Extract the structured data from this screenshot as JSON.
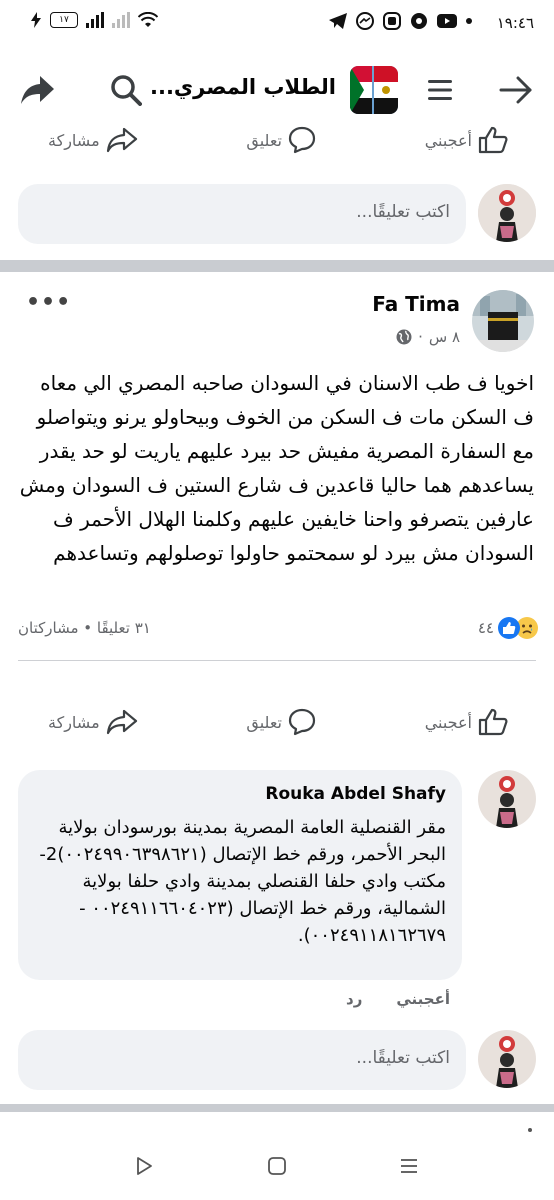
{
  "status_bar": {
    "time": "١٩:٤٦",
    "battery": "١٧"
  },
  "header": {
    "title": "الطلاب المصري...",
    "back_icon": "arrow-right-icon",
    "menu_icon": "hamburger-icon",
    "search_icon": "search-icon",
    "share_icon": "share-arrow-icon"
  },
  "prev_post_actions": {
    "like": "أعجبني",
    "comment": "تعليق",
    "share": "مشاركة"
  },
  "comment_input": {
    "placeholder": "اكتب تعليقًا..."
  },
  "post": {
    "author": "Fa Tima",
    "time": "٨ س",
    "dot": "·",
    "text": "اخويا ف طب الاسنان في السودان صاحبه المصري الي معاه ف السكن مات ف السكن من الخوف وبيحاولو يرنو ويتواصلو مع السفارة المصرية مفيش حد بيرد عليهم ياريت لو حد يقدر يساعدهم هما حاليا قاعدين ف شارع الستين ف السودان ومش عارفين يتصرفو واحنا خايفين عليهم وكلمنا الهلال الأحمر ف السودان مش بيرد لو سمحتمو حاولوا توصلولهم وتساعدهم",
    "reactions_count": "٤٤",
    "comments_shares": "٣١ تعليقًا • مشاركتان",
    "actions": {
      "like": "أعجبني",
      "comment": "تعليق",
      "share": "مشاركة"
    }
  },
  "comment": {
    "author": "Rouka Abdel Shafy",
    "text": "مقر القنصلية العامة المصرية بمدينة بورسودان بولاية البحر الأحمر، ورقم خط الإتصال (٠٠٢٤٩٩٠٦٣٩٨٦٢١)2- مكتب وادي حلفا القنصلي بمدينة وادي حلفا بولاية الشمالية، ورقم خط الإتصال (٠٠٢٤٩١١٦٦٠٤٠٢٣ - ٠٠٢٤٩١١٨١٦٢٦٧٩).",
    "like": "أعجبني",
    "reply": "رد"
  },
  "colors": {
    "accent": "#1877f2",
    "text_secondary": "#65676b",
    "bubble": "#f0f2f5",
    "separator": "#c9ccd1"
  }
}
